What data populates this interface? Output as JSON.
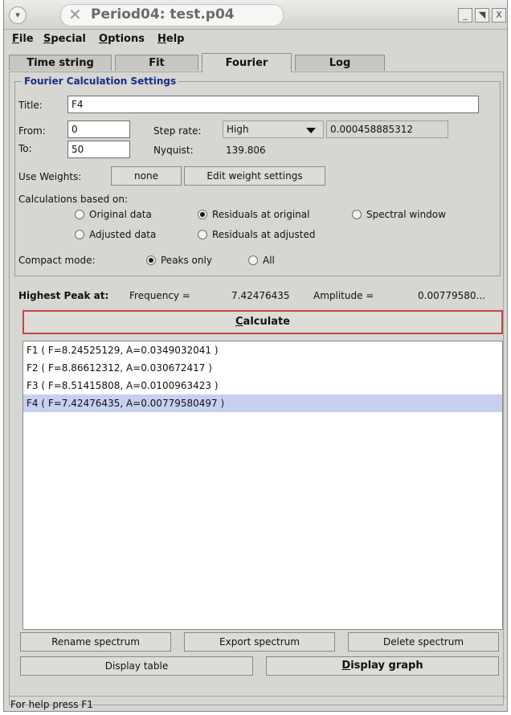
{
  "window": {
    "title": "Period04: test.p04",
    "menu_icon": "chevron-down-icon",
    "minimize_glyph": "_",
    "maximize_glyph": "◥",
    "close_glyph": "X"
  },
  "menubar": [
    "File",
    "Special",
    "Options",
    "Help"
  ],
  "tabs": [
    {
      "label": "Time string",
      "active": false
    },
    {
      "label": "Fit",
      "active": false
    },
    {
      "label": "Fourier",
      "active": true
    },
    {
      "label": "Log",
      "active": false
    }
  ],
  "settings": {
    "group_title": "Fourier Calculation Settings",
    "title_label": "Title:",
    "title_value": "F4",
    "from_label": "From:",
    "from_value": "0",
    "to_label": "To:",
    "to_value": "50",
    "step_rate_label": "Step rate:",
    "step_rate_value": "High",
    "step_value": "0.000458885312",
    "nyquist_label": "Nyquist:",
    "nyquist_value": "139.806",
    "use_weights_label": "Use Weights:",
    "weights_value": "none",
    "edit_weights_label": "Edit weight settings",
    "calc_based_label": "Calculations based on:",
    "radio_original": "Original data",
    "radio_residuals_original": "Residuals at original",
    "radio_spectral": "Spectral window",
    "radio_adjusted": "Adjusted data",
    "radio_residuals_adjusted": "Residuals at adjusted",
    "compact_label": "Compact mode:",
    "radio_peaks": "Peaks only",
    "radio_all": "All",
    "selected_basis": "Residuals at original",
    "selected_compact": "Peaks only"
  },
  "peak": {
    "label": "Highest Peak at:",
    "freq_label": "Frequency =",
    "freq_value": "7.42476435",
    "amp_label": "Amplitude =",
    "amp_value": "0.00779580..."
  },
  "calculate_label": "Calculate",
  "spectra": [
    {
      "text": "F1 ( F=8.24525129, A=0.0349032041 )",
      "selected": false
    },
    {
      "text": "F2 ( F=8.86612312, A=0.030672417 )",
      "selected": false
    },
    {
      "text": "F3 ( F=8.51415808, A=0.0100963423 )",
      "selected": false
    },
    {
      "text": "F4 ( F=7.42476435, A=0.00779580497 )",
      "selected": true
    }
  ],
  "buttons": {
    "rename": "Rename spectrum",
    "export": "Export spectrum",
    "delete": "Delete spectrum",
    "display_table": "Display table",
    "display_graph": "Display graph"
  },
  "status": "For help press F1"
}
